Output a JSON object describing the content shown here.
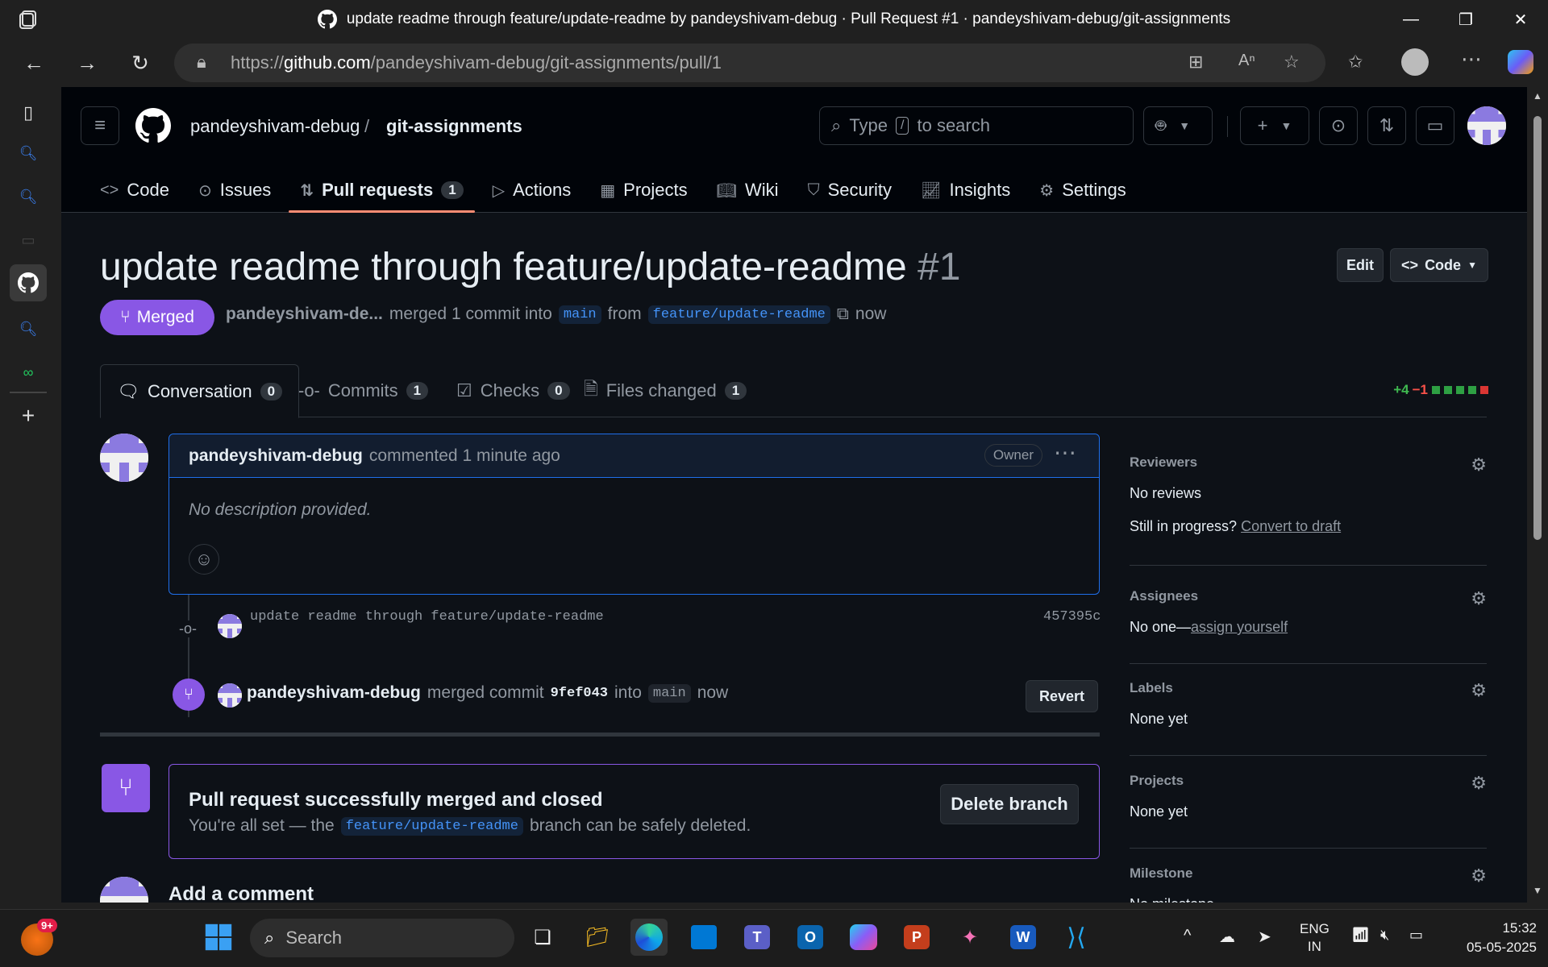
{
  "browser": {
    "window_title": "update readme through feature/update-readme by pandeyshivam-debug · Pull Request #1 · pandeyshivam-debug/git-assignments",
    "url_prefix": "https://",
    "url_domain": "github.com",
    "url_path": "/pandeyshivam-debug/git-assignments/pull/1"
  },
  "header": {
    "owner": "pandeyshivam-debug",
    "separator": "/",
    "repo": "git-assignments",
    "search_prefix": "Type",
    "search_key": "/",
    "search_suffix": "to search"
  },
  "repo_nav": [
    {
      "label": "Code",
      "icon": "code-icon"
    },
    {
      "label": "Issues",
      "icon": "issue-icon"
    },
    {
      "label": "Pull requests",
      "icon": "pull-request-icon",
      "count": "1",
      "selected": true
    },
    {
      "label": "Actions",
      "icon": "play-icon"
    },
    {
      "label": "Projects",
      "icon": "table-icon"
    },
    {
      "label": "Wiki",
      "icon": "book-icon"
    },
    {
      "label": "Security",
      "icon": "shield-icon"
    },
    {
      "label": "Insights",
      "icon": "graph-icon"
    },
    {
      "label": "Settings",
      "icon": "gear-icon"
    }
  ],
  "pr": {
    "title": "update readme through feature/update-readme",
    "number": "#1",
    "edit_label": "Edit",
    "code_label": "Code",
    "state": "Merged",
    "author": "pandeyshivam-de...",
    "merged_text": "merged 1 commit into",
    "base_branch": "main",
    "from_text": "from",
    "head_branch": "feature/update-readme",
    "time": "now"
  },
  "pr_tabs": [
    {
      "label": "Conversation",
      "count": "0",
      "selected": true
    },
    {
      "label": "Commits",
      "count": "1"
    },
    {
      "label": "Checks",
      "count": "0"
    },
    {
      "label": "Files changed",
      "count": "1"
    }
  ],
  "diffstat": {
    "additions": "+4",
    "deletions": "−1"
  },
  "comment": {
    "author": "pandeyshivam-debug",
    "action": "commented 1 minute ago",
    "badge": "Owner",
    "body": "No description provided."
  },
  "commit": {
    "message": "update readme through feature/update-readme",
    "sha": "457395c"
  },
  "merge_event": {
    "actor": "pandeyshivam-debug",
    "text": "merged commit",
    "sha": "9fef043",
    "into": "into",
    "branch": "main",
    "time": "now",
    "revert_label": "Revert"
  },
  "merged_box": {
    "title": "Pull request successfully merged and closed",
    "text_before": "You're all set — the",
    "branch": "feature/update-readme",
    "text_after": "branch can be safely deleted.",
    "delete_label": "Delete branch"
  },
  "add_comment": "Add a comment",
  "sidebar": {
    "reviewers_h": "Reviewers",
    "reviewers_v": "No reviews",
    "draft_q": "Still in progress?",
    "draft_link": "Convert to draft",
    "assignees_h": "Assignees",
    "assignees_v": "No one—",
    "assignees_link": "assign yourself",
    "labels_h": "Labels",
    "labels_v": "None yet",
    "projects_h": "Projects",
    "projects_v": "None yet",
    "milestone_h": "Milestone",
    "milestone_v": "No milestone"
  },
  "taskbar": {
    "notif_badge": "9+",
    "search": "Search",
    "lang1": "ENG",
    "lang2": "IN",
    "time": "15:32",
    "date": "05-05-2025"
  },
  "colors": {
    "merged": "#8957e5",
    "link": "#4493f8",
    "bg": "#0d1117",
    "tab_underline": "#fd8c73"
  }
}
